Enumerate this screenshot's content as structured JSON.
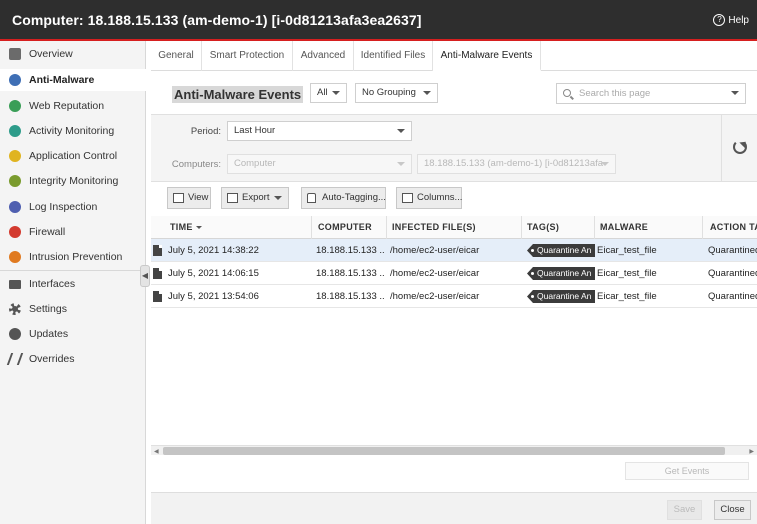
{
  "window": {
    "title": "Computer: 18.188.15.133 (am-demo-1) [i-0d81213afa3ea2637]",
    "help_label": "Help",
    "help_glyph": "?"
  },
  "sidebar": {
    "items": [
      {
        "label": "Overview",
        "icon": "overview-icon",
        "color": "#6b6b6b"
      },
      {
        "label": "Anti-Malware",
        "icon": "anti-malware-icon",
        "color": "#3f6fb5"
      },
      {
        "label": "Web Reputation",
        "icon": "web-reputation-icon",
        "color": "#3a9e57"
      },
      {
        "label": "Activity Monitoring",
        "icon": "activity-monitoring-icon",
        "color": "#2e9c8a"
      },
      {
        "label": "Application Control",
        "icon": "application-control-icon",
        "color": "#e0b420"
      },
      {
        "label": "Integrity Monitoring",
        "icon": "integrity-monitoring-icon",
        "color": "#7a9b2e"
      },
      {
        "label": "Log Inspection",
        "icon": "log-inspection-icon",
        "color": "#4f5fb0"
      },
      {
        "label": "Firewall",
        "icon": "firewall-icon",
        "color": "#d33a2f"
      },
      {
        "label": "Intrusion Prevention",
        "icon": "intrusion-prevention-icon",
        "color": "#e07a20"
      },
      {
        "label": "Interfaces",
        "icon": "interfaces-icon",
        "color": "#555555"
      },
      {
        "label": "Settings",
        "icon": "settings-icon",
        "color": "#555555"
      },
      {
        "label": "Updates",
        "icon": "updates-icon",
        "color": "#555555"
      },
      {
        "label": "Overrides",
        "icon": "overrides-icon",
        "color": "#555555"
      }
    ],
    "collapse_glyph": "◀"
  },
  "tabs": [
    {
      "label": "General"
    },
    {
      "label": "Smart Protection"
    },
    {
      "label": "Advanced"
    },
    {
      "label": "Identified Files"
    },
    {
      "label": "Anti-Malware Events"
    }
  ],
  "header": {
    "title": "Anti-Malware Events",
    "filter_value": "All",
    "grouping_value": "No Grouping",
    "search_placeholder": "Search this page"
  },
  "filters": {
    "period_label": "Period:",
    "period_value": "Last Hour",
    "computers_label": "Computers:",
    "computers_type": "Computer",
    "computers_value": "18.188.15.133 (am-demo-1) [i-0d81213afa"
  },
  "toolbar": {
    "view_label": "View",
    "export_label": "Export",
    "auto_tagging_label": "Auto-Tagging...",
    "columns_label": "Columns..."
  },
  "table": {
    "columns": [
      "TIME",
      "COMPUTER",
      "INFECTED FILE(S)",
      "TAG(S)",
      "MALWARE",
      "ACTION TA"
    ],
    "rows": [
      {
        "time": "July 5, 2021 14:38:22",
        "computer": "18.188.15.133 ...",
        "file": "/home/ec2-user/eicar",
        "tag": "Quarantine An",
        "malware": "Eicar_test_file",
        "action": "Quarantined"
      },
      {
        "time": "July 5, 2021 14:06:15",
        "computer": "18.188.15.133 ...",
        "file": "/home/ec2-user/eicar",
        "tag": "Quarantine An",
        "malware": "Eicar_test_file",
        "action": "Quarantined"
      },
      {
        "time": "July 5, 2021 13:54:06",
        "computer": "18.188.15.133 ...",
        "file": "/home/ec2-user/eicar",
        "tag": "Quarantine An",
        "malware": "Eicar_test_file",
        "action": "Quarantined"
      }
    ]
  },
  "scroll": {
    "left_glyph": "◀",
    "right_glyph": "▶"
  },
  "footer": {
    "get_events_label": "Get Events",
    "save_label": "Save",
    "close_label": "Close"
  }
}
